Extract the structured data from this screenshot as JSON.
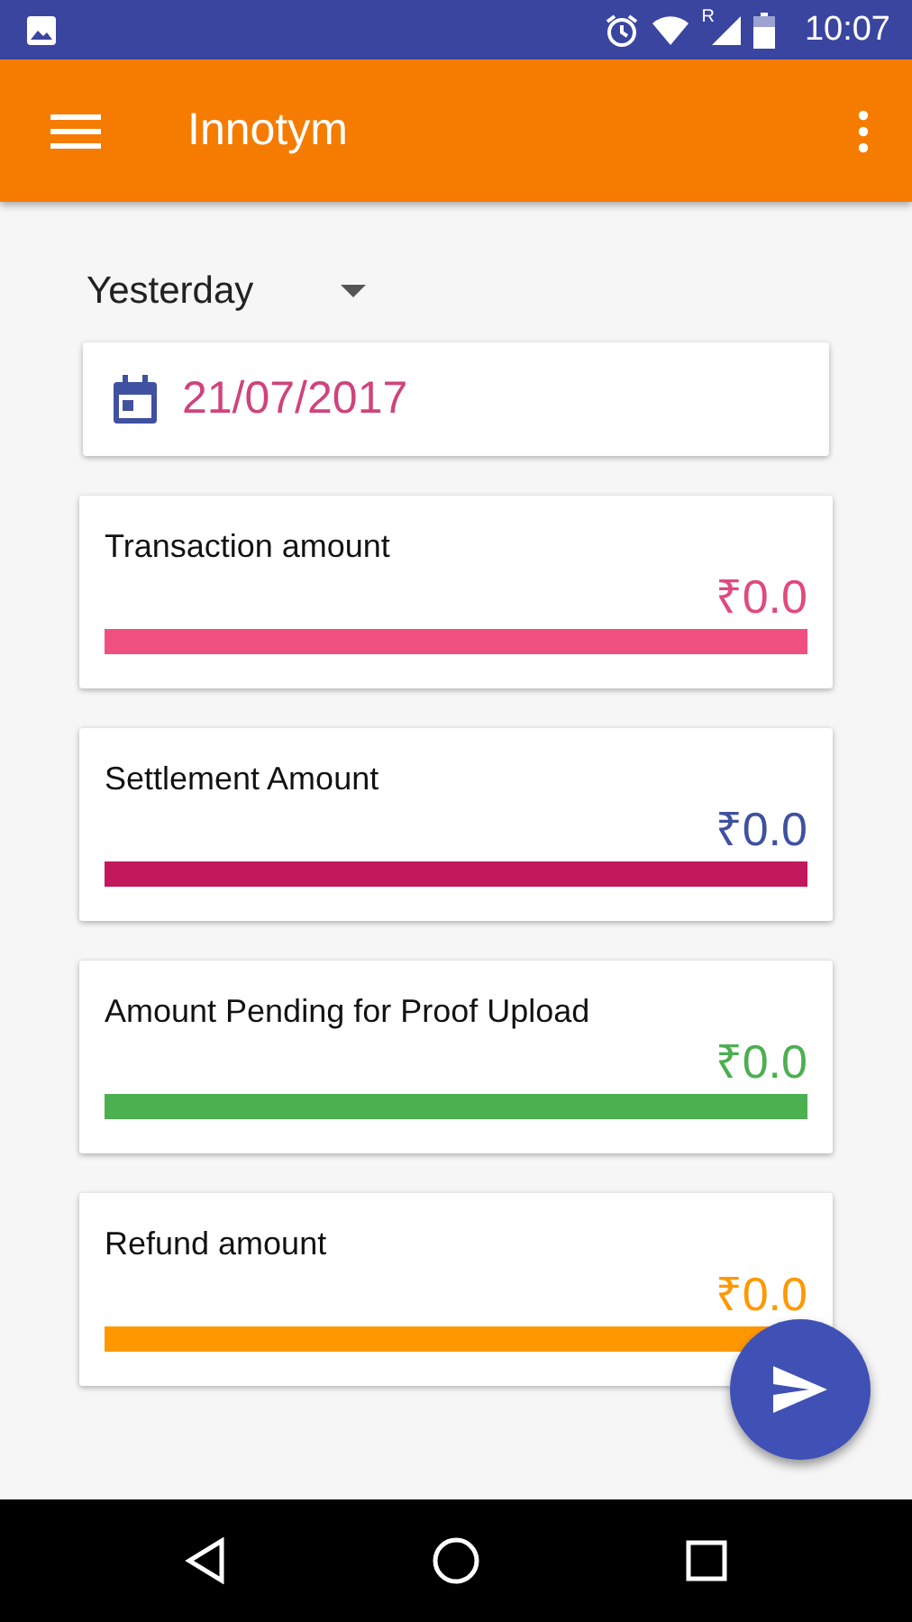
{
  "status_bar": {
    "roaming": "R",
    "time": "10:07"
  },
  "app_bar": {
    "title": "Innotym"
  },
  "period_dropdown": {
    "value": "Yesterday"
  },
  "date_field": {
    "value": "21/07/2017"
  },
  "cards": [
    {
      "title": "Transaction amount",
      "amount": {
        "value": "₹0.0",
        "color": "#e04a7e"
      },
      "color": "#f0507f"
    },
    {
      "title": "Settlement Amount",
      "amount": {
        "value": "₹0.0",
        "color": "#3f51a0"
      },
      "color": "#c2185b"
    },
    {
      "title": "Amount Pending for Proof Upload",
      "amount": {
        "value": "₹0.0",
        "color": "#4caf50"
      },
      "color": "#4caf50"
    },
    {
      "title": "Refund amount",
      "amount": {
        "value": "₹0.0",
        "color": "#ff9800"
      },
      "color": "#ff9800"
    }
  ]
}
